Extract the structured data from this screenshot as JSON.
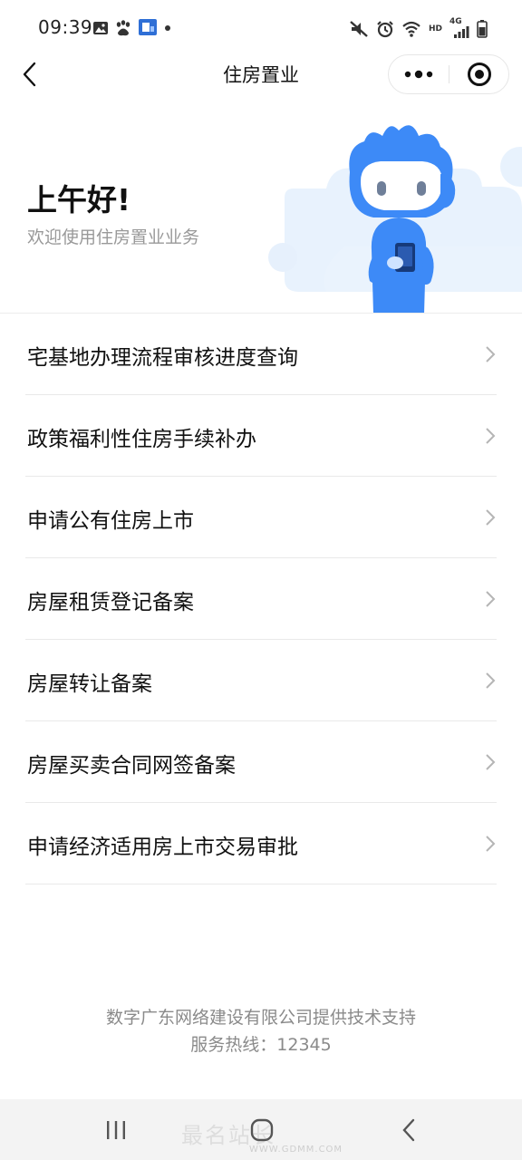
{
  "status_bar": {
    "time": "09:39",
    "left_icons": [
      "image-icon",
      "paw-icon",
      "app-badge-icon",
      "dot-icon"
    ],
    "right_icons": [
      "mute-icon",
      "alarm-icon",
      "wifi-icon",
      "hd-icon",
      "signal-4g-icon",
      "battery-icon"
    ],
    "hd_label": "HD",
    "network_label": "4G"
  },
  "nav": {
    "title": "住房置业"
  },
  "banner": {
    "greeting": "上午好!",
    "welcome": "欢迎使用住房置业业务",
    "accent_color": "#3d8af7"
  },
  "services": [
    {
      "label": "宅基地办理流程审核进度查询"
    },
    {
      "label": "政策福利性住房手续补办"
    },
    {
      "label": "申请公有住房上市"
    },
    {
      "label": "房屋租赁登记备案"
    },
    {
      "label": "房屋转让备案"
    },
    {
      "label": "房屋买卖合同网签备案"
    },
    {
      "label": "申请经济适用房上市交易审批"
    }
  ],
  "footer": {
    "support": "数字广东网络建设有限公司提供技术支持",
    "hotline": "服务热线：12345"
  },
  "watermark": {
    "text": "最名站长",
    "url": "WWW.GDMM.COM"
  }
}
